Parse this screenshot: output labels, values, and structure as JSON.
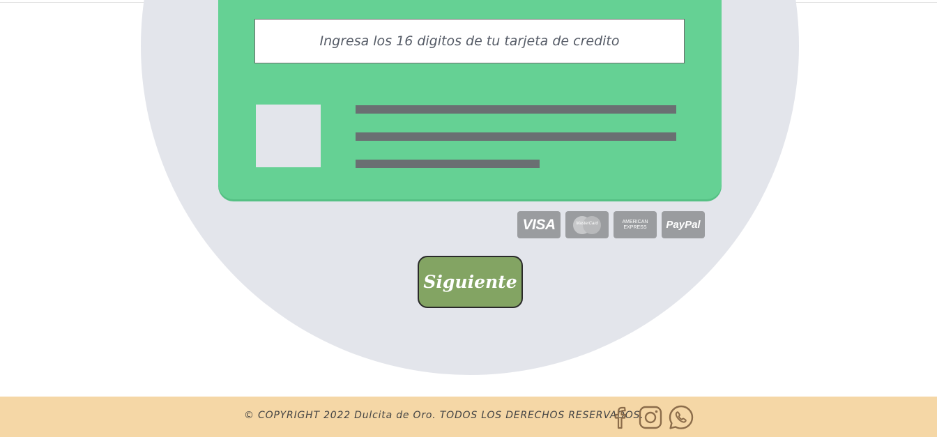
{
  "card": {
    "input_placeholder": "Ingresa los 16 digitos de tu tarjeta de credito",
    "input_value": ""
  },
  "payment_logos": {
    "visa": "VISA",
    "mastercard": "MasterCard",
    "amex_line1": "AMERICAN",
    "amex_line2": "EXPRESS",
    "paypal": "PayPal"
  },
  "actions": {
    "next_label": "Siguiente"
  },
  "footer": {
    "copyright": "© COPYRIGHT 2022 Dulcita de Oro. TODOS LOS DERECHOS RESERVADOS.",
    "social_icons": [
      "facebook-icon",
      "instagram-icon",
      "whatsapp-icon"
    ]
  },
  "colors": {
    "card_green": "#65d194",
    "background_circle": "#e3e5eb",
    "button_green": "#83a463",
    "footer_bg": "#f5d7a6",
    "icon_brown": "#8b6c4a",
    "logo_grey": "#9a9c9f"
  }
}
